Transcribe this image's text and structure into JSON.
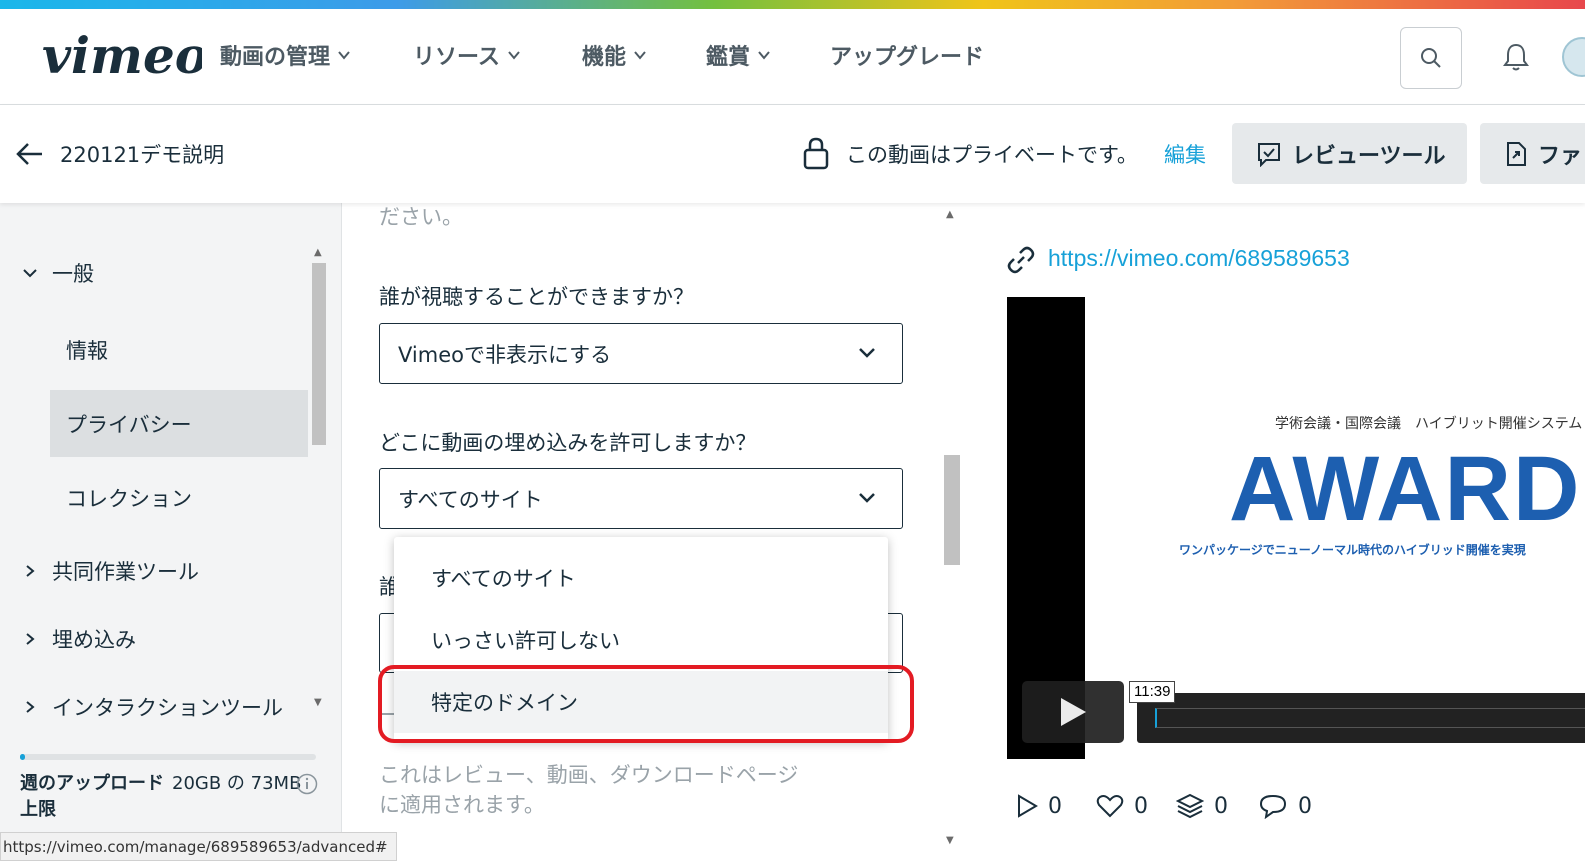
{
  "brand": "vimeo",
  "nav": {
    "items": [
      {
        "label": "動画の管理",
        "has_dropdown": true
      },
      {
        "label": "リソース",
        "has_dropdown": true
      },
      {
        "label": "機能",
        "has_dropdown": true
      },
      {
        "label": "鑑賞",
        "has_dropdown": true
      },
      {
        "label": "アップグレード",
        "has_dropdown": false
      }
    ]
  },
  "header": {
    "video_title": "220121デモ説明",
    "privacy_notice": "この動画はプライベートです。",
    "edit_link": "編集",
    "review_tool_label": "レビューツール",
    "file_button_label": "ファ"
  },
  "sidebar": {
    "general": "一般",
    "sub_items": [
      "情報",
      "プライバシー",
      "コレクション"
    ],
    "active_item": "プライバシー",
    "collab_tools": "共同作業ツール",
    "embed": "埋め込み",
    "interaction_tools": "インタラクションツール",
    "quota_label": "週のアップロード上限",
    "quota_value": "20GB の 73MB",
    "quota_fraction": 0.004
  },
  "main": {
    "faded_top": "ださい。",
    "q_who_can_view": "誰が視聴することができますか？",
    "view_selected": "Vimeoで非表示にする",
    "q_embed": "どこに動画の埋め込みを許可しますか？",
    "embed_selected": "すべてのサイト",
    "hidden_label_start": "誰",
    "embed_options": [
      "すべてのサイト",
      "いっさい許可しない",
      "特定のドメイン"
    ],
    "note_line1": "これはレビュー、動画、ダウンロードページ",
    "note_line2": "に適用されます。"
  },
  "right": {
    "video_url": "https://vimeo.com/689589653",
    "slide_subtitle": "学術会議・国際会議　ハイブリット開催システム",
    "slide_logo": "AWARD",
    "slide_tagline": "ワンパッケージでニューノーマル時代のハイブリッド開催を実現",
    "duration": "11:39",
    "stats": {
      "plays": "0",
      "likes": "0",
      "collections": "0",
      "comments": "0"
    }
  },
  "status_bar_url": "https://vimeo.com/manage/689589653/advanced#",
  "colors": {
    "accent": "#17a1d8",
    "highlight_box": "#e31b23",
    "award_blue": "#1d5fb0"
  }
}
